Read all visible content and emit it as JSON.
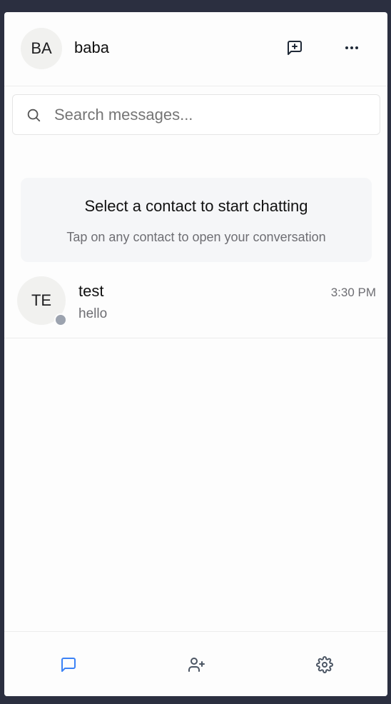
{
  "profile": {
    "initials": "BA",
    "name": "baba"
  },
  "search": {
    "placeholder": "Search messages...",
    "value": ""
  },
  "empty_state": {
    "title": "Select a contact to start chatting",
    "subtitle": "Tap on any contact to open your conversation"
  },
  "contacts": [
    {
      "initials": "TE",
      "name": "test",
      "time": "3:30 PM",
      "last_message": "hello",
      "status": "offline"
    }
  ],
  "icons": {
    "new_message": "message-plus-icon",
    "more": "more-horizontal-icon",
    "search": "search-icon",
    "chats": "chat-bubble-icon",
    "add_contact": "user-plus-icon",
    "settings": "gear-icon"
  },
  "colors": {
    "accent": "#3b82f6",
    "status_offline": "#9ca3af",
    "icon": "#4b5563",
    "backdrop": "#2b2f40"
  },
  "bottom_nav": {
    "active": "chats"
  }
}
